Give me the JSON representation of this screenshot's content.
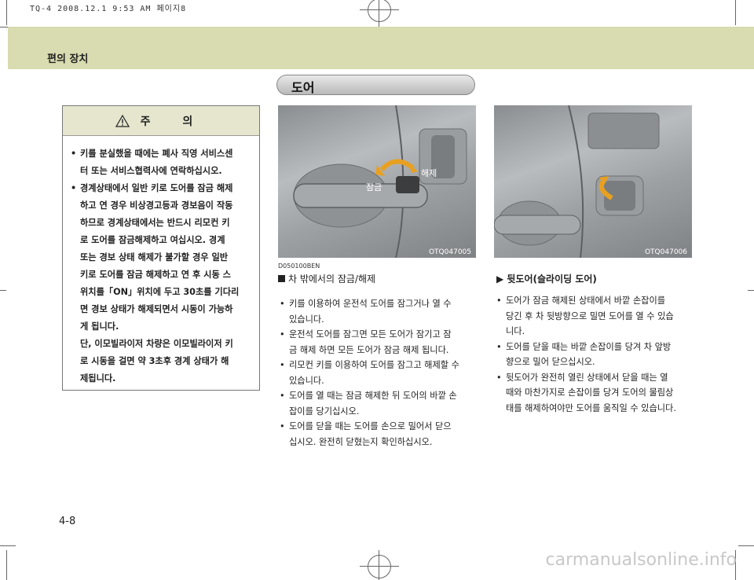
{
  "print_header": "TQ-4 2008.12.1 9:53 AM 페이지8",
  "section_title": "편의 장치",
  "caution": {
    "title": "주  의",
    "lines": [
      "키를 분실했을 때에는 폐사 직영 서비스센",
      "터 또는 서비스협력사에 연락하십시오.",
      "경계상태에서 일반 키로 도어를 잠금 해제",
      "하고 연 경우 비상경고등과 경보음이 작동",
      "하므로 경계상태에서는 반드시 리모컨 키",
      "로 도어를 잠금해제하고 여십시오. 경계",
      "또는 경보 상태 해제가 불가할 경우 일반",
      "키로 도어를 잠금 해제하고 연 후 시동 스",
      "위치를「ON」위치에 두고 30초를 기다리",
      "면 경보 상태가 해제되면서 시동이 가능하",
      "게 됩니다.",
      "단, 이모빌라이저 차량은 이모빌라이저 키",
      "로 시동을 걸면 약 3초후 경계 상태가 해",
      "제됩니다."
    ]
  },
  "door_heading": "도어",
  "photo_left": {
    "code": "OTQ047005",
    "label_lock": "잠금",
    "label_unlock": "해제"
  },
  "photo_right": {
    "code": "OTQ047006"
  },
  "ref_code": "D050100BEN",
  "sub_title": "차 밖에서의 잠금/해제",
  "left_items": [
    "키를 이용하여 운전석 도어를 잠그거나 열 수",
    "있습니다.",
    "운전석 도어를 잠그면 모든 도어가 잠기고 잠",
    "금 해제 하면 모든 도어가 잠금 해제 됩니다.",
    "리모컨 키를 이용하여 도어를 잠그고 해제할 수",
    "있습니다.",
    "도어를 열 때는 잠금 해제한 뒤 도어의 바깥 손",
    "잡이를 당기십시오.",
    "도어를 닫을 때는 도어를 손으로 밀어서 닫으",
    "십시오. 완전히 닫혔는지 확인하십시오."
  ],
  "right_title": "▶ 뒷도어(슬라이딩 도어)",
  "right_items": [
    "도어가 잠금 해제된 상태에서 바깥 손잡이를",
    "당긴 후 차 뒷방향으로 밀면 도어를 열 수 있습",
    "니다.",
    "도어를 닫을 때는 바깥 손잡이를 당겨 차 앞방",
    "향으로 밀어 닫으십시오.",
    "뒷도어가 완전히 열린 상태에서 닫을 때는 열",
    "때와 마찬가지로 손잡이를 당겨 도어의 물림상",
    "태를 해제하여야만 도어를 움직일 수 있습니다."
  ],
  "page_number": "4-8",
  "watermark": "carmanualsonline.info"
}
